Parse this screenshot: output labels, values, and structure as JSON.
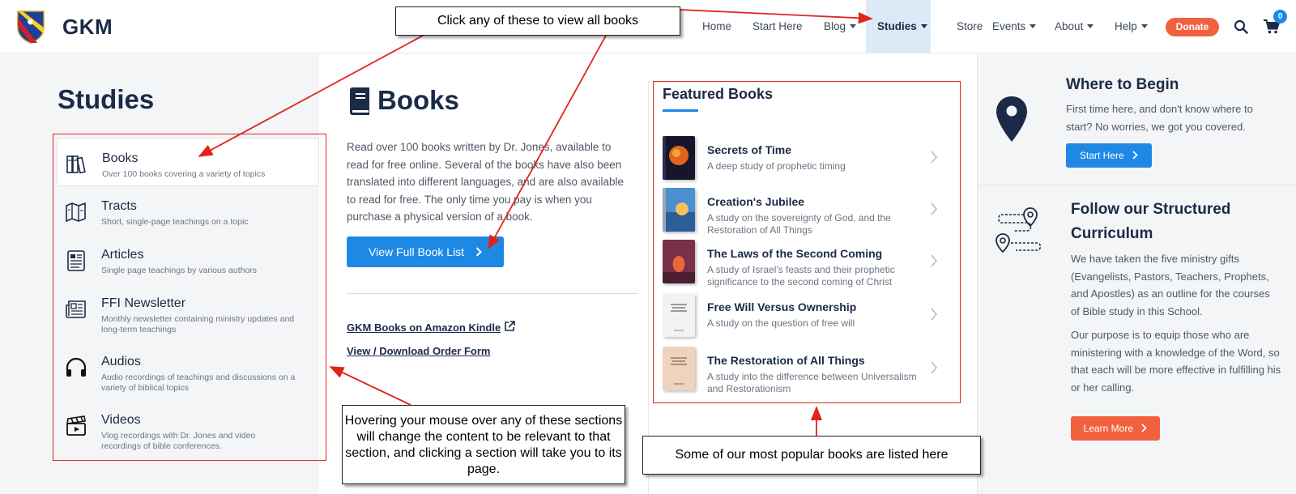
{
  "header": {
    "logo_text": "GKM",
    "nav": [
      {
        "label": "Home",
        "caret": false,
        "active": false
      },
      {
        "label": "Start Here",
        "caret": false,
        "active": false
      },
      {
        "label": "Blog",
        "caret": true,
        "active": false
      },
      {
        "label": "Studies",
        "caret": true,
        "active": true
      },
      {
        "label": "Store",
        "caret": false,
        "active": false
      },
      {
        "label": "Events",
        "caret": true,
        "active": false
      },
      {
        "label": "About",
        "caret": true,
        "active": false
      },
      {
        "label": "Help",
        "caret": true,
        "active": false
      }
    ],
    "donate_label": "Donate",
    "cart_count": "0"
  },
  "studies": {
    "title": "Studies",
    "items": [
      {
        "label": "Books",
        "desc": "Over 100 books covering a variety of topics",
        "icon": "books-icon"
      },
      {
        "label": "Tracts",
        "desc": "Short, single-page teachings on a topic",
        "icon": "map-icon"
      },
      {
        "label": "Articles",
        "desc": "Single page teachings by various authors",
        "icon": "article-icon"
      },
      {
        "label": "FFI Newsletter",
        "desc": "Monthly newsletter containing ministry updates and long-term teachings",
        "icon": "newspaper-icon"
      },
      {
        "label": "Audios",
        "desc": "Audio recordings of teachings and discussions on a variety of biblical topics",
        "icon": "headphones-icon"
      },
      {
        "label": "Videos",
        "desc": "Vlog recordings with Dr. Jones and video recordings of bible conferences.",
        "icon": "clapperboard-icon"
      }
    ]
  },
  "books": {
    "title": "Books",
    "desc": "Read over 100 books written by Dr. Jones, available to read for free online. Several of the books have also been translated into different languages, and are also available to read for free. The only time you pay is when you purchase a physical version of a book.",
    "button_label": "View Full Book List",
    "link_kindle": "GKM Books on Amazon Kindle",
    "link_order_form": "View / Download Order Form"
  },
  "featured": {
    "title": "Featured Books",
    "items": [
      {
        "title": "Secrets of Time",
        "desc": "A deep study of prophetic timing"
      },
      {
        "title": "Creation's Jubilee",
        "desc": "A study on the sovereignty of God, and the Restoration of All Things"
      },
      {
        "title": "The Laws of the Second Coming",
        "desc": "A study of Israel's feasts and their prophetic significance to the second coming of Christ"
      },
      {
        "title": "Free Will Versus Ownership",
        "desc": "A study on the question of free will"
      },
      {
        "title": "The Restoration of All Things",
        "desc": "A study into the difference between Universalism and Restorationism"
      }
    ]
  },
  "right": {
    "where_title": "Where to Begin",
    "where_desc": "First time here, and don't know where to start? No worries, we got you covered.",
    "start_label": "Start Here",
    "follow_title": "Follow our Structured Curriculum",
    "follow_desc1": "We have taken the five ministry gifts (Evangelists, Pastors, Teachers, Prophets, and Apostles) as an outline for the courses of Bible study in this School.",
    "follow_desc2": "Our purpose is to equip those who are ministering with a knowledge of the Word, so that each will be more effective in fulfilling his or her calling.",
    "learn_label": "Learn More"
  },
  "annotations": {
    "top": "Click any of these to view all books",
    "left": "Hovering your mouse over any of these sections will change the content to be relevant to that section, and clicking a section will take you to its page.",
    "right": "Some of our most popular books are listed here"
  },
  "colors": {
    "accent": "#1e88e5",
    "donate": "#f2613f",
    "annotation_red": "#e0241b",
    "navy": "#1b2a47"
  }
}
